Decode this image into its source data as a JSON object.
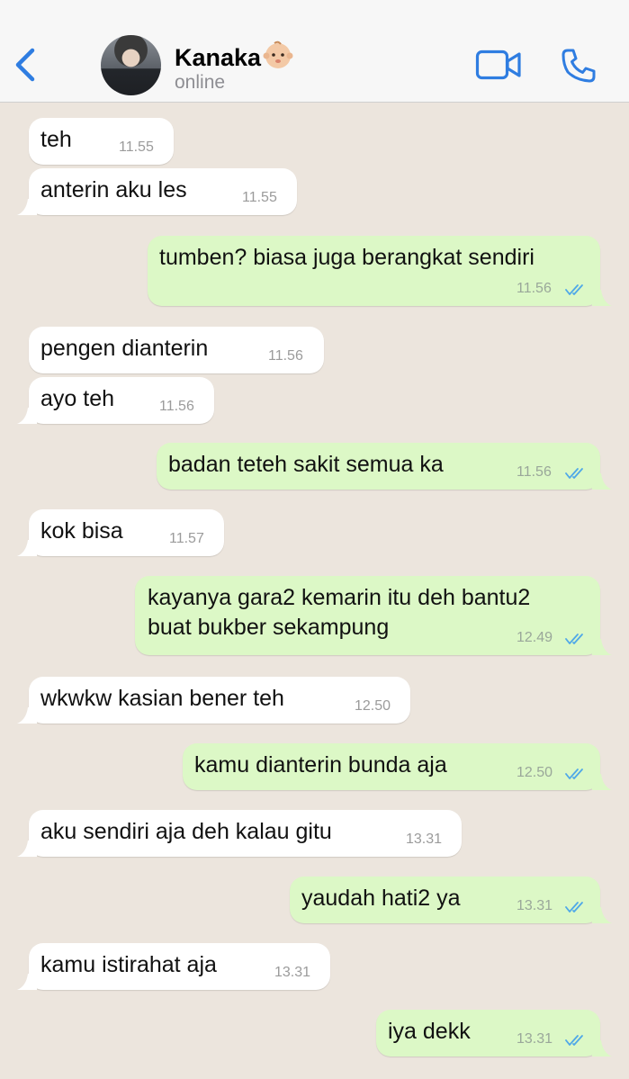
{
  "header": {
    "contact_name": "Kanaka",
    "status": "online"
  },
  "icons": {
    "back": "chevron-left-icon",
    "video": "video-camera-icon",
    "call": "phone-icon",
    "read": "double-check-icon",
    "emoji": "baby-emoji"
  },
  "colors": {
    "accent": "#2f7de1",
    "incoming_bubble": "#ffffff",
    "outgoing_bubble": "#dcf8c6",
    "chat_background": "#ece5dd",
    "read_tick": "#4fa8e8"
  },
  "messages": [
    {
      "dir": "in",
      "text": "teh",
      "time": "11.55"
    },
    {
      "dir": "in",
      "text": "anterin aku les",
      "time": "11.55"
    },
    {
      "dir": "out",
      "text": "tumben? biasa juga berangkat sendiri",
      "time": "11.56"
    },
    {
      "dir": "in",
      "text": "pengen dianterin",
      "time": "11.56"
    },
    {
      "dir": "in",
      "text": "ayo teh",
      "time": "11.56"
    },
    {
      "dir": "out",
      "text": "badan teteh sakit semua ka",
      "time": "11.56"
    },
    {
      "dir": "in",
      "text": "kok bisa",
      "time": "11.57"
    },
    {
      "dir": "out",
      "text": "kayanya gara2 kemarin itu deh bantu2\nbuat bukber sekampung",
      "time": "12.49"
    },
    {
      "dir": "in",
      "text": "wkwkw kasian bener teh",
      "time": "12.50"
    },
    {
      "dir": "out",
      "text": "kamu dianterin bunda aja",
      "time": "12.50"
    },
    {
      "dir": "in",
      "text": "aku sendiri aja deh kalau gitu",
      "time": "13.31"
    },
    {
      "dir": "out",
      "text": "yaudah hati2 ya",
      "time": "13.31"
    },
    {
      "dir": "in",
      "text": "kamu istirahat aja",
      "time": "13.31"
    },
    {
      "dir": "out",
      "text": "iya dekk",
      "time": "13.31"
    }
  ]
}
